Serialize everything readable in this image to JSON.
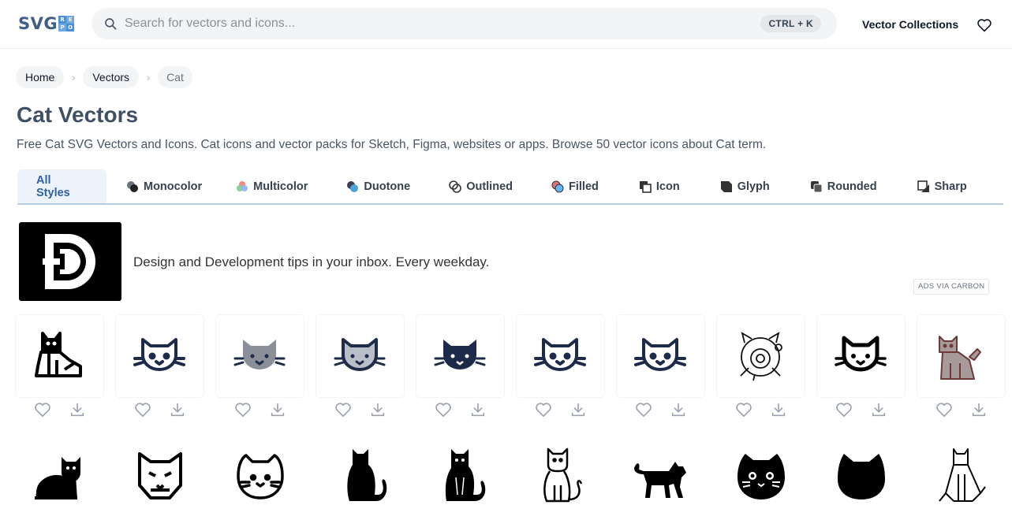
{
  "logo": {
    "text": "SVG",
    "grid": [
      "RE",
      "PO"
    ]
  },
  "search": {
    "placeholder": "Search for vectors and icons...",
    "shortcut": "CTRL + K"
  },
  "nav": {
    "collections": "Vector Collections"
  },
  "breadcrumb": [
    "Home",
    "Vectors",
    "Cat"
  ],
  "page": {
    "title": "Cat Vectors",
    "subtitle": "Free Cat SVG Vectors and Icons. Cat icons and vector packs for Sketch, Figma, websites or apps. Browse 50 vector icons about Cat term."
  },
  "tabs": [
    {
      "label": "All Styles",
      "icon": "none",
      "active": true
    },
    {
      "label": "Monocolor",
      "icon": "monocolor-icon"
    },
    {
      "label": "Multicolor",
      "icon": "multicolor-icon"
    },
    {
      "label": "Duotone",
      "icon": "duotone-icon"
    },
    {
      "label": "Outlined",
      "icon": "outlined-icon"
    },
    {
      "label": "Filled",
      "icon": "filled-icon"
    },
    {
      "label": "Icon",
      "icon": "icon-style-icon"
    },
    {
      "label": "Glyph",
      "icon": "glyph-icon"
    },
    {
      "label": "Rounded",
      "icon": "rounded-icon"
    },
    {
      "label": "Sharp",
      "icon": "sharp-icon"
    }
  ],
  "ad": {
    "text": "Design and Development tips in your inbox. Every weekday.",
    "via": "ADS VIA CARBON"
  },
  "icons_row1": [
    "cat-sitting-outline",
    "cat-face-outline",
    "cat-face-gray",
    "cat-face-duotone",
    "cat-face-filled-navy",
    "cat-face-outline-2",
    "cat-face-outline-3",
    "cat-robot-sketch",
    "cat-face-bold",
    "cat-sitting-multicolor"
  ],
  "icons_row2": [
    "cat-lying-black",
    "cat-face-angular",
    "cat-face-round",
    "cat-back-silhouette",
    "cat-sitting-black",
    "cat-sitting-outline-2",
    "cat-walking-black",
    "cat-face-black-round",
    "cat-head-silhouette",
    "cat-sitting-line"
  ],
  "colors": {
    "brand": "#3f5d86",
    "accent": "#2f5fa8",
    "navy": "#1e2a4a"
  }
}
